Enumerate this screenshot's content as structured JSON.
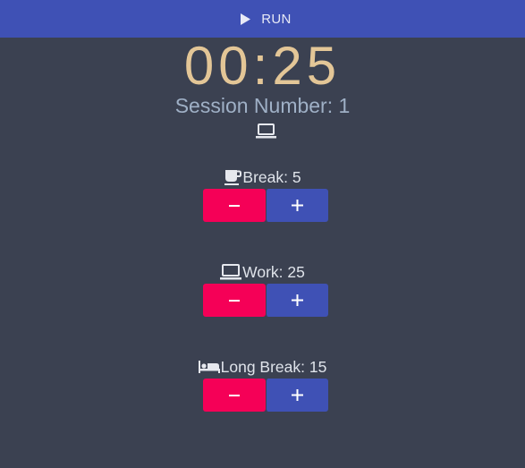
{
  "header": {
    "run_label": "RUN",
    "run_icon": "play-icon",
    "color": "#3f51b5"
  },
  "timer": {
    "display": "00:25",
    "color": "#e3c697"
  },
  "session": {
    "label": "Session Number: 1",
    "icon": "laptop-icon"
  },
  "settings": [
    {
      "key": "break",
      "label": "Break: 5",
      "icon": "coffee-cup-icon",
      "value": 5
    },
    {
      "key": "work",
      "label": "Work: 25",
      "icon": "laptop-icon",
      "value": 25
    },
    {
      "key": "long_break",
      "label": "Long Break: 15",
      "icon": "bed-icon",
      "value": 15
    }
  ],
  "colors": {
    "decrement": "#f50057",
    "increment": "#3f51b5",
    "background": "#3b4151"
  }
}
